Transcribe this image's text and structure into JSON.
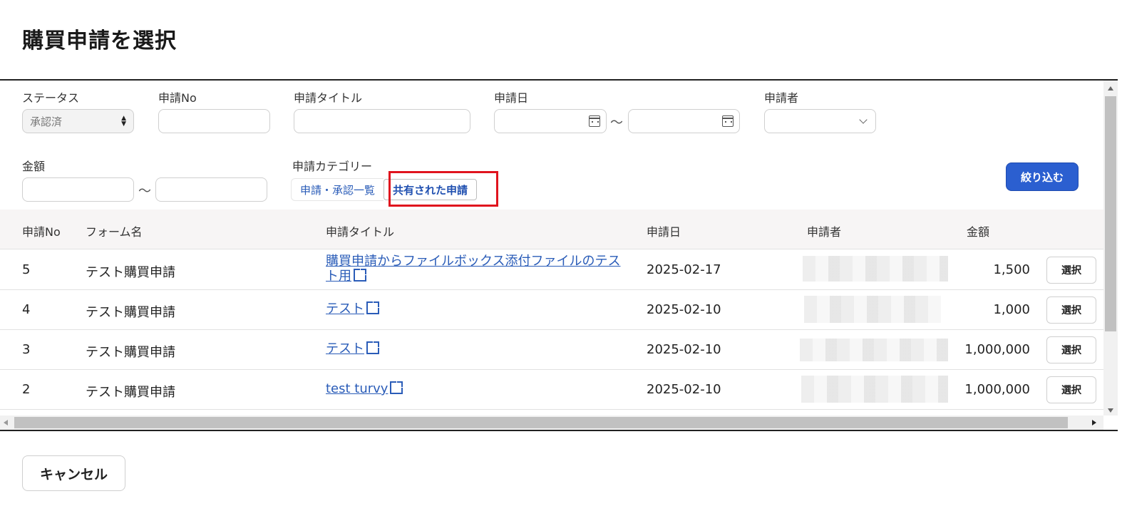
{
  "page": {
    "title": "購買申請を選択"
  },
  "filters": {
    "status_label": "ステータス",
    "status_value": "承認済",
    "no_label": "申請No",
    "title_label": "申請タイトル",
    "date_label": "申請日",
    "applicant_label": "申請者",
    "amount_label": "金額",
    "category_label": "申請カテゴリー",
    "range_sep": "～",
    "category_tabs": [
      {
        "label": "申請・承認一覧",
        "active": false
      },
      {
        "label": "共有された申請",
        "active": true
      }
    ],
    "filter_button": "絞り込む"
  },
  "table": {
    "headers": [
      "申請No",
      "フォーム名",
      "申請タイトル",
      "申請日",
      "申請者",
      "金額"
    ],
    "select_label": "選択",
    "rows": [
      {
        "no": "5",
        "form": "テスト購買申請",
        "title": "購買申請からファイルボックス添付ファイルのテスト用",
        "date": "2025-02-17",
        "amount": "1,500"
      },
      {
        "no": "4",
        "form": "テスト購買申請",
        "title": "テスト",
        "date": "2025-02-10",
        "amount": "1,000"
      },
      {
        "no": "3",
        "form": "テスト購買申請",
        "title": "テスト",
        "date": "2025-02-10",
        "amount": "1,000,000"
      },
      {
        "no": "2",
        "form": "テスト購買申請",
        "title": "test turvy",
        "date": "2025-02-10",
        "amount": "1,000,000"
      }
    ]
  },
  "footer": {
    "cancel_label": "キャンセル"
  },
  "colors": {
    "primary": "#2b5fd0",
    "link": "#2a5cb8",
    "highlight": "#e0141e"
  }
}
